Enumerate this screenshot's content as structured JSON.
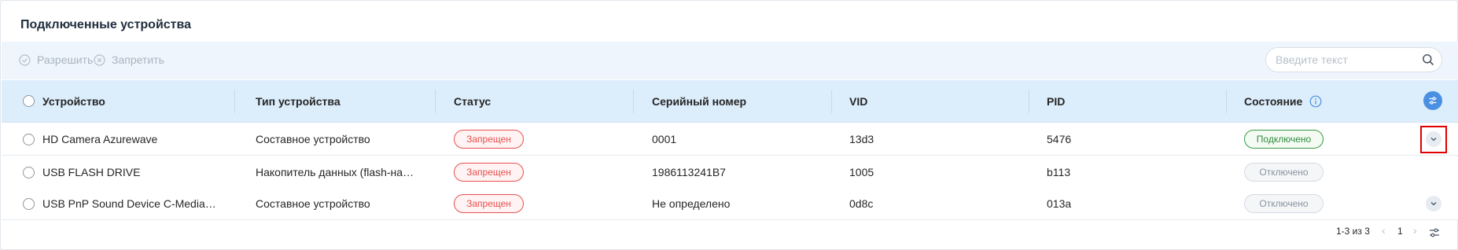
{
  "page": {
    "title": "Подключенные устройства"
  },
  "toolbar": {
    "allow_label": "Разрешить",
    "deny_label": "Запретить",
    "search_placeholder": "Введите текст"
  },
  "table": {
    "headers": {
      "device": "Устройство",
      "type": "Тип устройства",
      "status": "Статус",
      "serial": "Серийный номер",
      "vid": "VID",
      "pid": "PID",
      "state": "Состояние"
    },
    "rows": [
      {
        "device": "HD Camera Azurewave",
        "type": "Составное устройство",
        "status": "Запрещен",
        "serial": "0001",
        "vid": "13d3",
        "pid": "5476",
        "state": "Подключено",
        "state_kind": "connected",
        "expand": true
      },
      {
        "device": "USB FLASH DRIVE",
        "type": "Накопитель данных (flash-на…",
        "status": "Запрещен",
        "serial": "1986113241B7",
        "vid": "1005",
        "pid": "b113",
        "state": "Отключено",
        "state_kind": "disconnected",
        "expand": false
      },
      {
        "device": "USB PnP Sound Device C-Media…",
        "type": "Составное устройство",
        "status": "Запрещен",
        "serial": "Не определено",
        "vid": "0d8c",
        "pid": "013a",
        "state": "Отключено",
        "state_kind": "disconnected",
        "expand": true
      }
    ]
  },
  "pagination": {
    "info": "1-3 из 3",
    "current_page": "1",
    "prev_icon": "chevron-left-icon",
    "next_icon": "chevron-right-icon"
  },
  "colors": {
    "accent": "#4a90e2",
    "denied": "#e8504f",
    "connected": "#2f8a3d",
    "highlight": "#e00000"
  }
}
